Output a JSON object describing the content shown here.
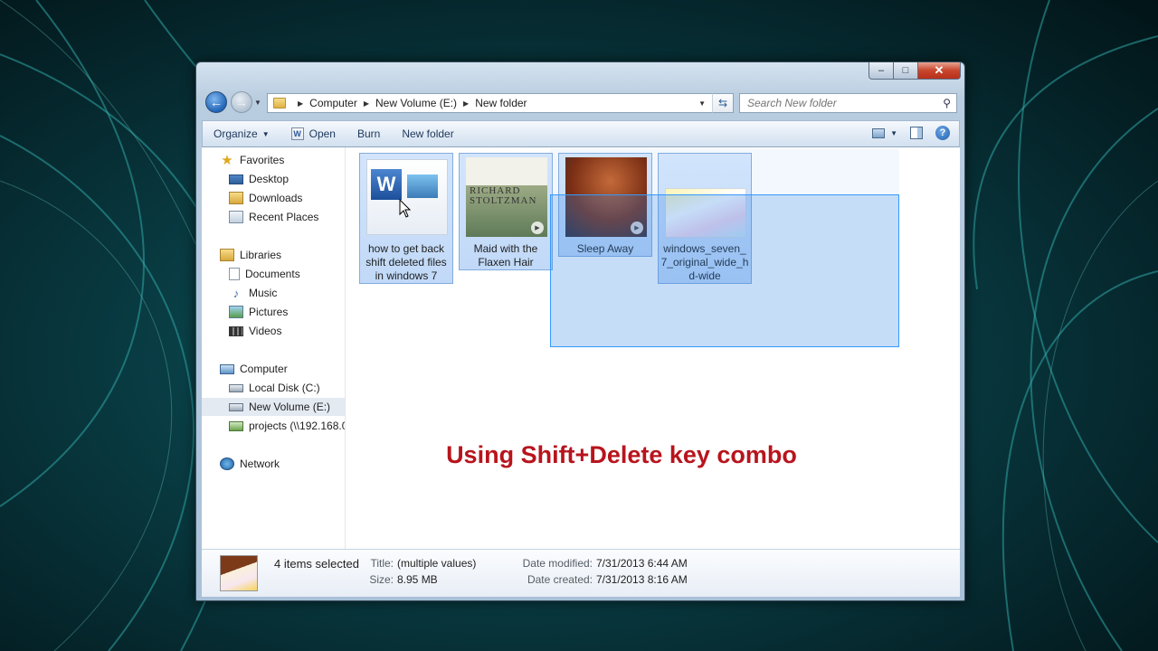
{
  "window": {
    "caption": {
      "minimize": "–",
      "maximize": "□",
      "close": "✕"
    }
  },
  "address_bar": {
    "crumbs": [
      "Computer",
      "New Volume (E:)",
      "New folder"
    ],
    "search_placeholder": "Search New folder"
  },
  "toolbar": {
    "organize": "Organize",
    "open": "Open",
    "burn": "Burn",
    "new_folder": "New folder"
  },
  "nav_pane": {
    "favorites": {
      "label": "Favorites",
      "items": [
        "Desktop",
        "Downloads",
        "Recent Places"
      ]
    },
    "libraries": {
      "label": "Libraries",
      "items": [
        "Documents",
        "Music",
        "Pictures",
        "Videos"
      ]
    },
    "computer": {
      "label": "Computer",
      "items": [
        "Local Disk (C:)",
        "New Volume (E:)",
        "projects (\\\\192.168.0"
      ]
    },
    "network": {
      "label": "Network"
    },
    "selected": "New Volume (E:)"
  },
  "files": [
    {
      "name": "how to get back shift deleted files in windows 7",
      "kind": "word-document",
      "thumb_text": "W"
    },
    {
      "name": "Maid with the Flaxen Hair",
      "kind": "music",
      "thumb_text": "RICHARD STOLTZMAN"
    },
    {
      "name": "Sleep Away",
      "kind": "music",
      "thumb_text": ""
    },
    {
      "name": "windows_seven_7_original_wide_hd-wide",
      "kind": "image",
      "thumb_text": ""
    }
  ],
  "overlay_caption": "Using Shift+Delete key combo",
  "details": {
    "summary": "4 items selected",
    "title_label": "Title:",
    "title_value": "(multiple values)",
    "size_label": "Size:",
    "size_value": "8.95 MB",
    "modified_label": "Date modified:",
    "modified_value": "7/31/2013 6:44 AM",
    "created_label": "Date created:",
    "created_value": "7/31/2013 8:16 AM"
  },
  "colors": {
    "selection": "#3385e6",
    "overlay_text": "#b8141d",
    "wallpaper": "#093d44"
  }
}
